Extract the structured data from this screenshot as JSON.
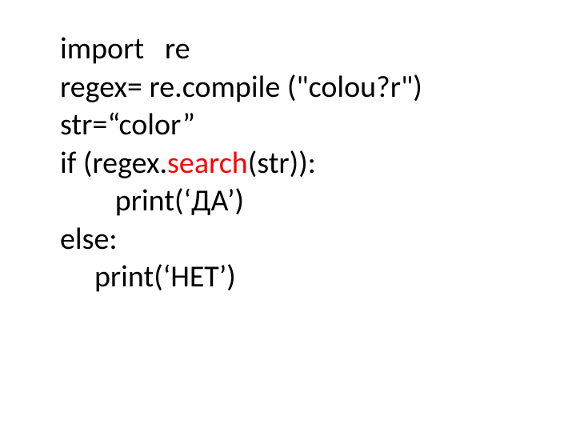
{
  "code": {
    "l1": "import   re",
    "l2": "regex= re.compile (\"colou?r\")",
    "l3": "str=“color”",
    "l4a": "if (regex.",
    "l4b": "search",
    "l4c": "(str)):",
    "l5": "        print(‘ДА’)",
    "l6": "еlse:",
    "l7": "     print(‘НЕТ’)"
  }
}
